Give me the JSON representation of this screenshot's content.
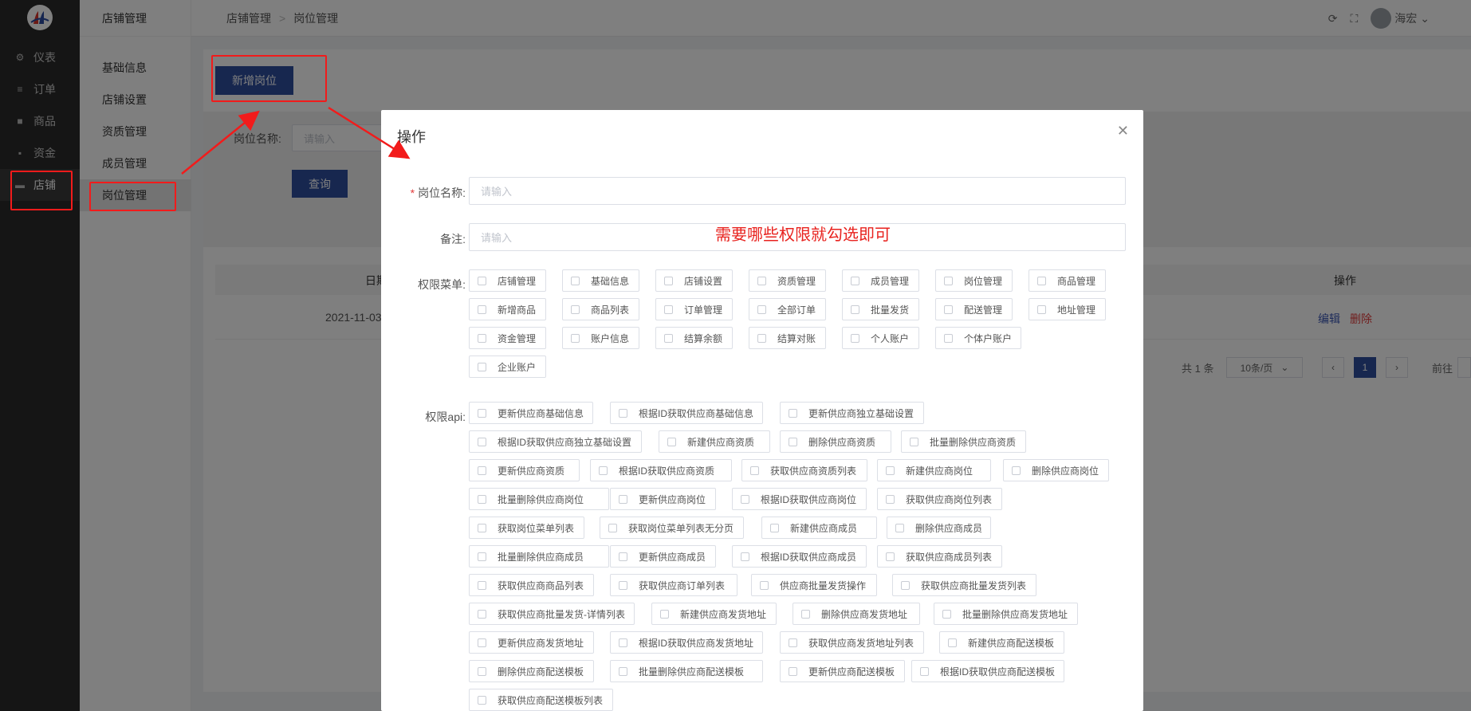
{
  "sidebar": {
    "items": [
      {
        "label": "仪表",
        "icon": "gear-icon"
      },
      {
        "label": "订单",
        "icon": "list-icon"
      },
      {
        "label": "商品",
        "icon": "bag-icon"
      },
      {
        "label": "资金",
        "icon": "wallet-icon"
      },
      {
        "label": "店铺",
        "icon": "store-icon"
      }
    ]
  },
  "subnav": {
    "header": "店铺管理",
    "items": [
      "基础信息",
      "店铺设置",
      "资质管理",
      "成员管理",
      "岗位管理"
    ]
  },
  "topbar": {
    "breadcrumb": [
      "店铺管理",
      "岗位管理"
    ],
    "user": "海宏"
  },
  "page": {
    "add_button": "新增岗位",
    "filter_label": "岗位名称:",
    "filter_placeholder": "请输入",
    "query_button": "查询",
    "table_header_date": "日期",
    "table_header_action": "操作",
    "row_date": "2021-11-03",
    "row_edit": "编辑",
    "row_delete": "删除",
    "total": "共 1 条",
    "page_size": "10条/页",
    "current_page": "1",
    "goto_label": "前往"
  },
  "modal": {
    "title": "操作",
    "name_label": "岗位名称:",
    "name_placeholder": "请输入",
    "remark_label": "备注:",
    "remark_placeholder": "请输入",
    "annotation": "需要哪些权限就勾选即可",
    "menu_label": "权限菜单:",
    "api_label": "权限api:",
    "menu_items": [
      "店铺管理",
      "基础信息",
      "店铺设置",
      "资质管理",
      "成员管理",
      "岗位管理",
      "商品管理",
      "新增商品",
      "商品列表",
      "订单管理",
      "全部订单",
      "批量发货",
      "配送管理",
      "地址管理",
      "资金管理",
      "账户信息",
      "结算余额",
      "结算对账",
      "个人账户",
      "个体户账户",
      "企业账户"
    ],
    "api_items": [
      "更新供应商基础信息",
      "根据ID获取供应商基础信息",
      "更新供应商独立基础设置",
      "根据ID获取供应商独立基础设置",
      "新建供应商资质",
      "删除供应商资质",
      "批量删除供应商资质",
      "更新供应商资质",
      "根据ID获取供应商资质",
      "获取供应商资质列表",
      "新建供应商岗位",
      "删除供应商岗位",
      "批量删除供应商岗位",
      "更新供应商岗位",
      "根据ID获取供应商岗位",
      "获取供应商岗位列表",
      "获取岗位菜单列表",
      "获取岗位菜单列表无分页",
      "新建供应商成员",
      "删除供应商成员",
      "批量删除供应商成员",
      "更新供应商成员",
      "根据ID获取供应商成员",
      "获取供应商成员列表",
      "获取供应商商品列表",
      "获取供应商订单列表",
      "供应商批量发货操作",
      "获取供应商批量发货列表",
      "获取供应商批量发货-详情列表",
      "新建供应商发货地址",
      "删除供应商发货地址",
      "批量删除供应商发货地址",
      "更新供应商发货地址",
      "根据ID获取供应商发货地址",
      "获取供应商发货地址列表",
      "新建供应商配送模板",
      "删除供应商配送模板",
      "批量删除供应商配送模板",
      "更新供应商配送模板",
      "根据ID获取供应商配送模板",
      "获取供应商配送模板列表"
    ]
  },
  "colors": {
    "primary": "#2f4f9f",
    "annotation_red": "#f21b1b",
    "sidebar_bg": "#2b2b2b"
  }
}
